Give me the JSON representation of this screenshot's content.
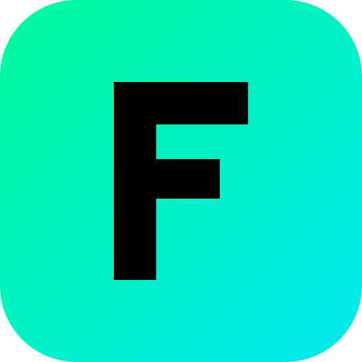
{
  "icon": {
    "letter": "F",
    "gradient_start": "#00fa9a",
    "gradient_end": "#00e8f0",
    "letter_color": "#000000"
  }
}
